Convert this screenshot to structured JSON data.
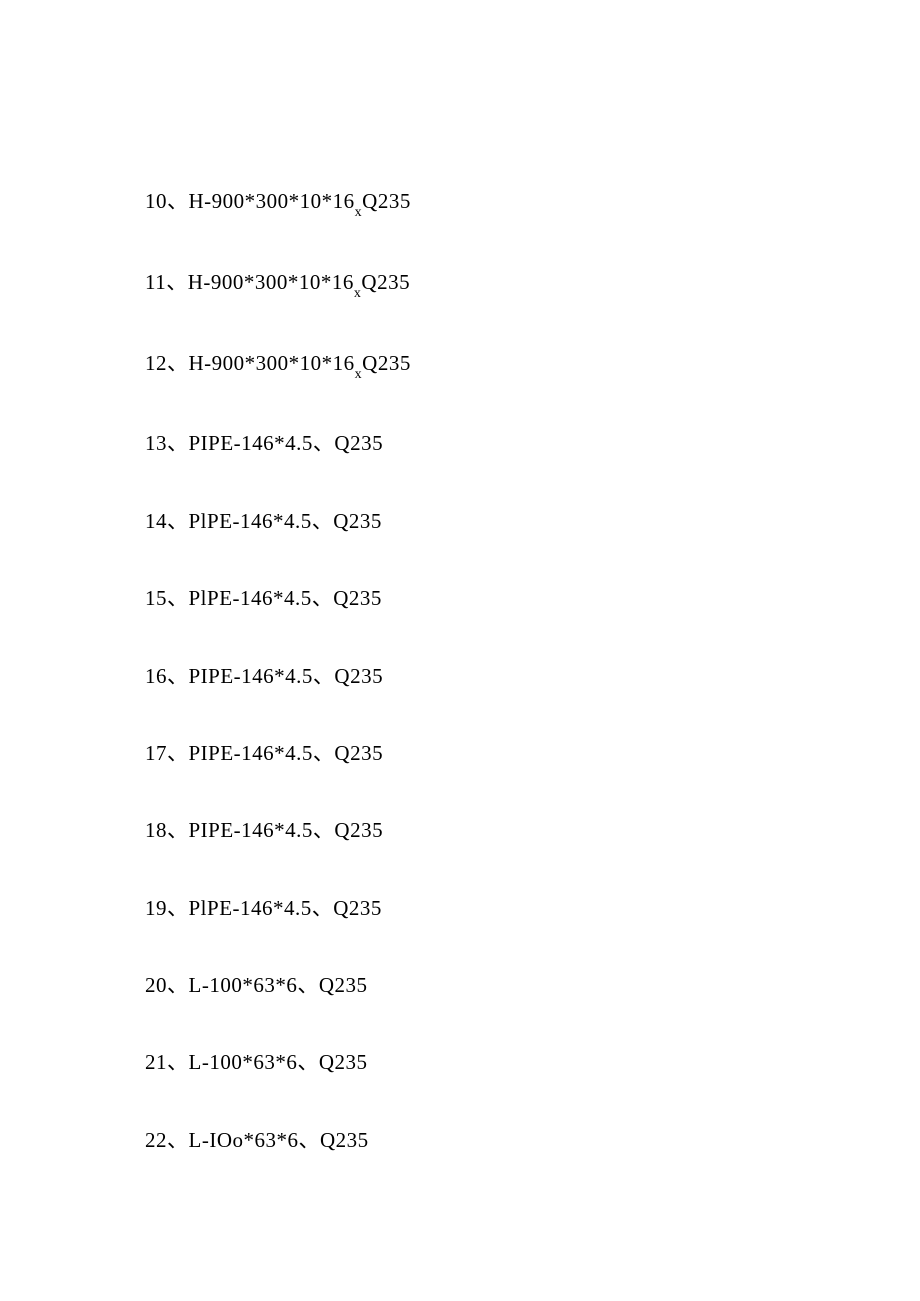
{
  "lines": [
    {
      "num": "10",
      "text_a": "H-900*300*10*16",
      "sub": "x",
      "text_b": "Q235"
    },
    {
      "num": "11",
      "text_a": "H-900*300*10*16",
      "sub": "x",
      "text_b": "Q235"
    },
    {
      "num": "12",
      "text_a": "H-900*300*10*16",
      "sub": "x",
      "text_b": "Q235"
    },
    {
      "num": "13",
      "text_a": "PIPE-146*4.5、Q235",
      "sub": "",
      "text_b": ""
    },
    {
      "num": "14",
      "text_a": "PlPE-146*4.5、Q235",
      "sub": "",
      "text_b": ""
    },
    {
      "num": "15",
      "text_a": "PlPE-146*4.5、Q235",
      "sub": "",
      "text_b": ""
    },
    {
      "num": "16",
      "text_a": "PIPE-146*4.5、Q235",
      "sub": "",
      "text_b": ""
    },
    {
      "num": "17",
      "text_a": "PIPE-146*4.5、Q235",
      "sub": "",
      "text_b": ""
    },
    {
      "num": "18",
      "text_a": "PIPE-146*4.5、Q235",
      "sub": "",
      "text_b": ""
    },
    {
      "num": "19",
      "text_a": "PlPE-146*4.5、Q235",
      "sub": "",
      "text_b": ""
    },
    {
      "num": "20",
      "text_a": "L-100*63*6、Q235",
      "sub": "",
      "text_b": ""
    },
    {
      "num": "21",
      "text_a": "L-100*63*6、Q235",
      "sub": "",
      "text_b": ""
    },
    {
      "num": "22",
      "text_a": "L-IOo*63*6、Q235",
      "sub": "",
      "text_b": ""
    }
  ]
}
